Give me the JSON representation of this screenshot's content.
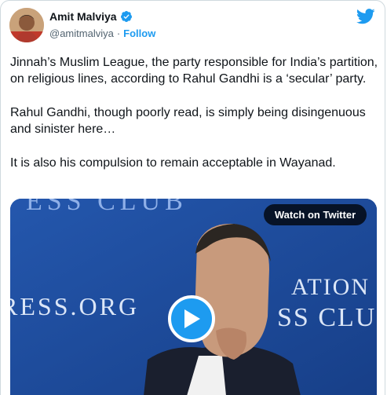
{
  "author": {
    "name": "Amit Malviya",
    "handle": "@amitmalviya",
    "separator": "·",
    "follow_label": "Follow"
  },
  "icons": {
    "verified": "verified-badge-icon",
    "twitter": "twitter-bird-icon",
    "play": "play-icon"
  },
  "tweet": {
    "paragraphs": [
      "Jinnah’s Muslim League, the party responsible for India’s partition, on religious lines, according to Rahul Gandhi is a ‘secular’ party.",
      "Rahul Gandhi, though poorly read, is simply being disingenuous and sinister here…",
      "It is also his compulsion to remain acceptable in Wayanad."
    ]
  },
  "media": {
    "watch_label": "Watch on Twitter",
    "background_text": {
      "top": "ESS CLUB",
      "left": "RESS.ORG",
      "right_top": "ATION",
      "right_bottom": "SS CLU"
    }
  },
  "colors": {
    "brand": "#1d9bf0",
    "text": "#0f1419",
    "secondary": "#536471",
    "media_bg": "#1e4fa0"
  }
}
